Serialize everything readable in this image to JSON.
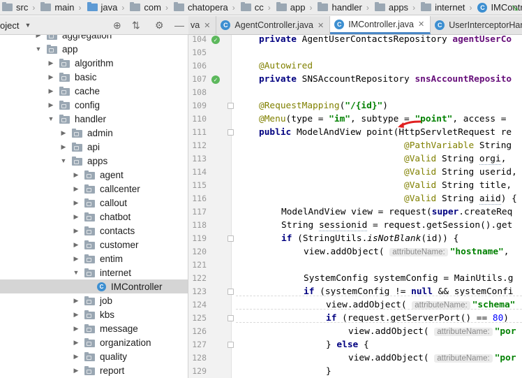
{
  "breadcrumb": [
    {
      "label": "src",
      "icon": "folder-icon"
    },
    {
      "label": "main",
      "icon": "folder-icon"
    },
    {
      "label": "java",
      "icon": "source-folder-icon"
    },
    {
      "label": "com",
      "icon": "folder-icon"
    },
    {
      "label": "chatopera",
      "icon": "folder-icon"
    },
    {
      "label": "cc",
      "icon": "folder-icon"
    },
    {
      "label": "app",
      "icon": "folder-icon"
    },
    {
      "label": "handler",
      "icon": "folder-icon"
    },
    {
      "label": "apps",
      "icon": "folder-icon"
    },
    {
      "label": "internet",
      "icon": "folder-icon"
    },
    {
      "label": "IMController",
      "icon": "class-icon"
    }
  ],
  "project_panel": {
    "title": "oject",
    "tree": [
      {
        "label": "aggregation",
        "expanded": false
      },
      {
        "label": "app",
        "expanded": true
      },
      {
        "label": "algorithm",
        "expanded": false
      },
      {
        "label": "basic",
        "expanded": false
      },
      {
        "label": "cache",
        "expanded": false
      },
      {
        "label": "config",
        "expanded": false
      },
      {
        "label": "handler",
        "expanded": true
      },
      {
        "label": "admin",
        "expanded": false
      },
      {
        "label": "api",
        "expanded": false
      },
      {
        "label": "apps",
        "expanded": true
      },
      {
        "label": "agent",
        "expanded": false
      },
      {
        "label": "callcenter",
        "expanded": false
      },
      {
        "label": "callout",
        "expanded": false
      },
      {
        "label": "chatbot",
        "expanded": false
      },
      {
        "label": "contacts",
        "expanded": false
      },
      {
        "label": "customer",
        "expanded": false
      },
      {
        "label": "entim",
        "expanded": false
      },
      {
        "label": "internet",
        "expanded": true
      },
      {
        "label": "IMController",
        "selected": true
      },
      {
        "label": "job",
        "expanded": false
      },
      {
        "label": "kbs",
        "expanded": false
      },
      {
        "label": "message",
        "expanded": false
      },
      {
        "label": "organization",
        "expanded": false
      },
      {
        "label": "quality",
        "expanded": false
      },
      {
        "label": "report",
        "expanded": false
      }
    ]
  },
  "tabs": [
    {
      "label": "va",
      "active": false
    },
    {
      "label": "AgentController.java",
      "active": false
    },
    {
      "label": "IMController.java",
      "active": true
    },
    {
      "label": "UserInterceptorHandler.java",
      "active": false
    }
  ],
  "editor": {
    "line_numbers": [
      "104",
      "105",
      "106",
      "107",
      "108",
      "109",
      "110",
      "111",
      "112",
      "113",
      "114",
      "115",
      "116",
      "117",
      "118",
      "119",
      "120",
      "121",
      "122",
      "123",
      "124",
      "125",
      "126",
      "127",
      "128",
      "129"
    ],
    "hints": {
      "attribute_name": "attributeName:"
    },
    "code": {
      "l104_kw": "private ",
      "l104_type": "AgentUserContactsRepository ",
      "l104_fld": "agentUserCo",
      "l106_ann": "@Autowired",
      "l107_kw": "private ",
      "l107_type": "SNSAccountRepository ",
      "l107_fld": "snsAccountReposito",
      "l109_ann": "@RequestMapping",
      "l109_a": "(",
      "l109_str": "\"/{id}\"",
      "l109_b": ")",
      "l110_ann": "@Menu",
      "l110_a": "(type = ",
      "l110_s1": "\"im\"",
      "l110_b": ", subtype = ",
      "l110_s2": "\"point\"",
      "l110_c": ", access = ",
      "l111_kw": "public ",
      "l111_a": "ModelAndView point(HttpServletRequest re",
      "l112_ann": "@PathVariable ",
      "l112_a": "String",
      "l113_ann": "@Valid ",
      "l113_a": "String ",
      "l113_b": "orgi",
      "l113_c": ",",
      "l114_ann": "@Valid ",
      "l114_a": "String userid,",
      "l115_ann": "@Valid ",
      "l115_a": "String title,",
      "l116_ann": "@Valid ",
      "l116_a": "String ",
      "l116_b": "aiid",
      "l116_c": ") {",
      "l117_a": "ModelAndView view = request(",
      "l117_kw": "super",
      "l117_b": ".createReq",
      "l118_a": "String ",
      "l118_b": "sessionid",
      "l118_c": " = request.getSession().get",
      "l119_kw": "if ",
      "l119_a": "(StringUtils.",
      "l119_it": "isNotBlank",
      "l119_b": "(id)) {",
      "l120_a": "view.addObject( ",
      "l120_str": "\"hostname\"",
      "l120_b": ",",
      "l122_a": "SystemConfig systemConfig = MainUtils.g",
      "l123_kw": "if ",
      "l123_a": "(systemConfig != ",
      "l123_kw2": "null",
      "l123_b": " && systemConfi",
      "l124_a": "view.addObject( ",
      "l124_str": "\"schema\"",
      "l125_kw": "if ",
      "l125_a": "(request.getServerPort() == ",
      "l125_num": "80",
      "l125_b": ")",
      "l126_a": "view.addObject( ",
      "l126_str": "\"por",
      "l127_a": "} ",
      "l127_kw": "else",
      "l127_b": " {",
      "l128_a": "view.addObject( ",
      "l128_str": "\"por",
      "l129_a": "}"
    }
  }
}
